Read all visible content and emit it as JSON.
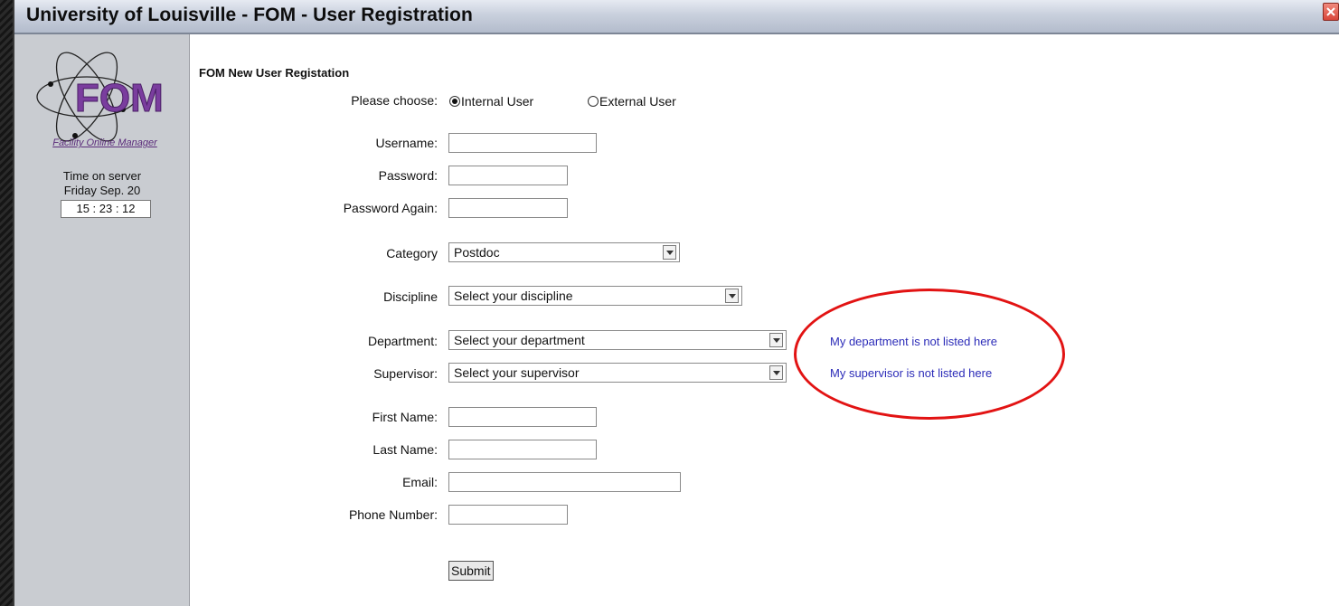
{
  "window": {
    "title": "University of Louisville - FOM - User Registration"
  },
  "sidebar": {
    "logo_text": "FOM",
    "logo_caption": "Facility Online Manager",
    "server_label": "Time on server",
    "server_date": "Friday Sep. 20",
    "server_time": "15 : 23 : 12"
  },
  "form": {
    "heading": "FOM New User Registation",
    "choose_label": "Please choose:",
    "user_type": {
      "internal_label": "Internal User",
      "external_label": "External User",
      "selected": "internal"
    },
    "username_label": "Username:",
    "password_label": "Password:",
    "password_again_label": "Password Again:",
    "category_label": "Category",
    "category_value": "Postdoc",
    "discipline_label": "Discipline",
    "discipline_value": "Select your discipline",
    "department_label": "Department:",
    "department_value": "Select your department",
    "supervisor_label": "Supervisor:",
    "supervisor_value": "Select your supervisor",
    "first_name_label": "First Name:",
    "last_name_label": "Last Name:",
    "email_label": "Email:",
    "phone_label": "Phone Number:",
    "submit_label": "Submit"
  },
  "links": {
    "department_missing": "My department is not listed here",
    "supervisor_missing": "My supervisor is not listed here"
  },
  "colors": {
    "highlight_ellipse": "#e21313",
    "link": "#2b2bb8",
    "logo_purple": "#7a3d9e"
  }
}
